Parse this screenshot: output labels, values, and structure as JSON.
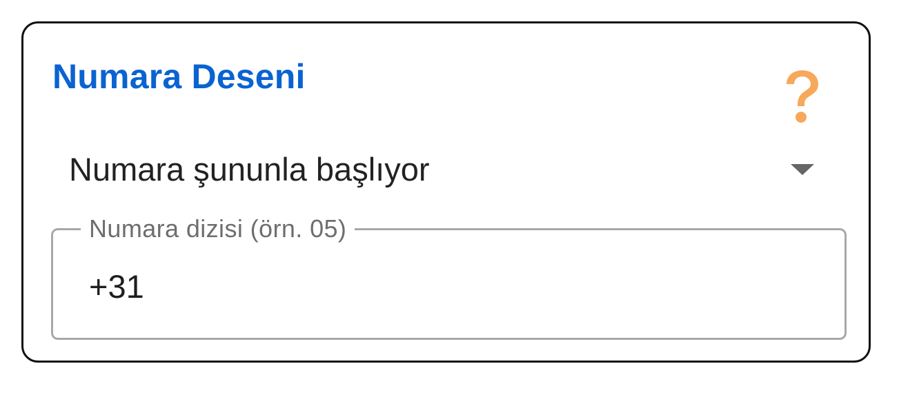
{
  "section": {
    "title": "Numara Deseni",
    "help_icon": "question-mark-icon",
    "help_icon_color": "#f7a85a",
    "title_color": "#0a63d1"
  },
  "match_type": {
    "selected": "Numara şununla başlıyor",
    "arrow_icon": "dropdown-arrow-icon"
  },
  "number_field": {
    "label": "Numara dizisi (örn. 05)",
    "value": "+31"
  }
}
